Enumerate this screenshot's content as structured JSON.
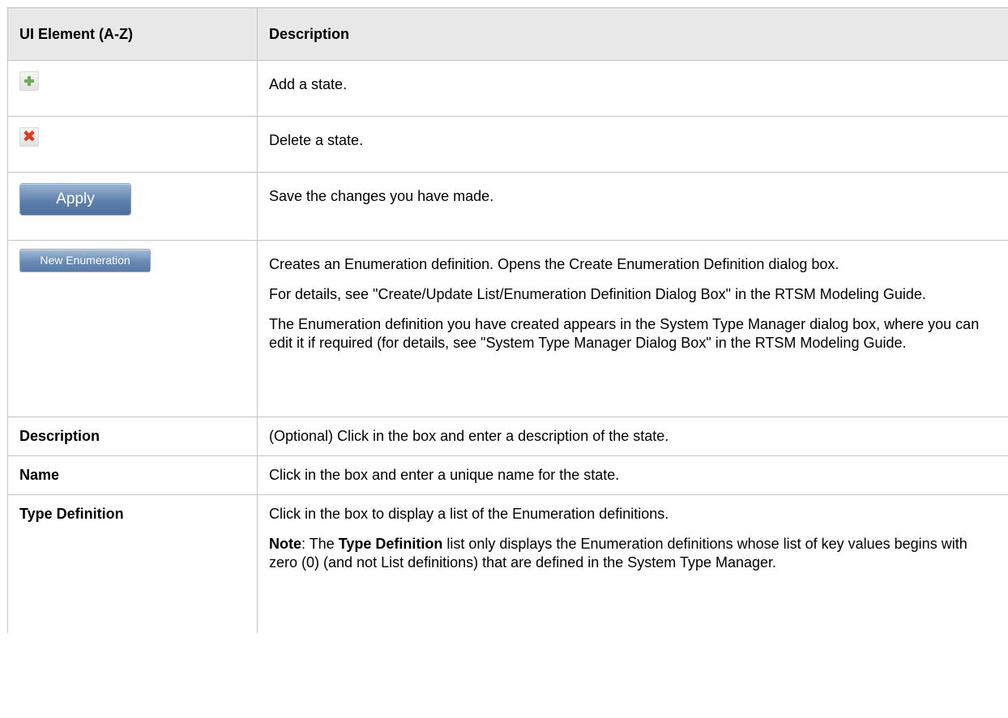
{
  "header": {
    "col_element": "UI Element (A-Z)",
    "col_description": "Description"
  },
  "rows": [
    {
      "icon": "add-icon",
      "description": [
        "Add a state."
      ]
    },
    {
      "icon": "delete-icon",
      "description": [
        "Delete a state."
      ]
    },
    {
      "button_label": "Apply",
      "description": [
        "Save the changes you have made."
      ]
    },
    {
      "button_label": "New Enumeration",
      "description": [
        "Creates an Enumeration definition. Opens the Create Enumeration Definition dialog box.",
        "For details, see \"Create/Update List/Enumeration Definition Dialog Box\" in the RTSM Modeling Guide.",
        "The Enumeration definition you have created appears in the System Type Manager dialog box, where you can edit it if required (for details, see \"System Type Manager Dialog Box\" in the RTSM Modeling Guide."
      ]
    },
    {
      "name": "Description",
      "description": [
        "(Optional) Click in the box and enter a description of the state."
      ]
    },
    {
      "name": "Name",
      "description": [
        "Click in the box and enter a unique name for the state."
      ]
    },
    {
      "name": "Type Definition",
      "description": [
        "Click in the box to display a list of the Enumeration definitions."
      ],
      "note": {
        "label": "Note",
        "sep": ": The ",
        "term": "Type Definition",
        "rest": " list only displays the Enumeration definitions whose list of key values begins with zero (0) (and not List definitions) that are defined in the System Type Manager."
      }
    }
  ]
}
